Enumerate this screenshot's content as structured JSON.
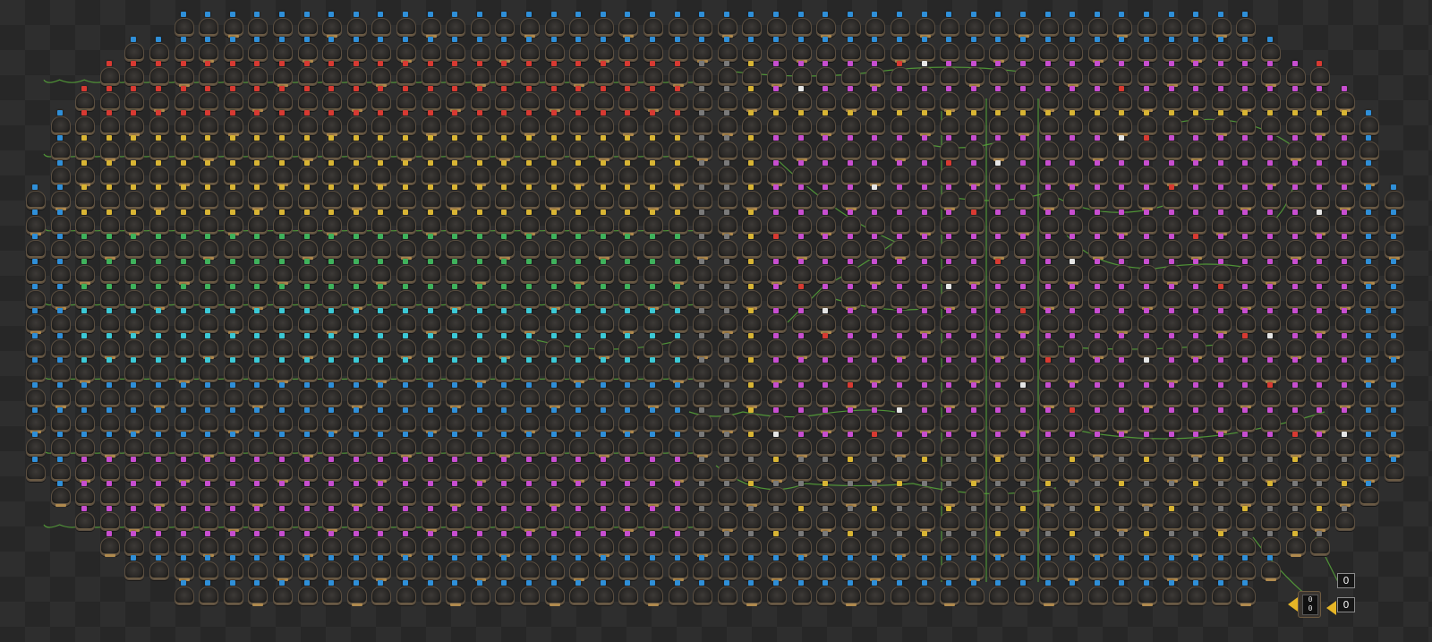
{
  "scene": "factorio-lamp-display",
  "signal_colors": {
    "blue": "#2f8fd8",
    "red": "#d83a32",
    "yellow": "#d9b534",
    "green": "#3fb25c",
    "cyan": "#3cc9d6",
    "magenta": "#c84ed0",
    "white": "#e6e6e6",
    "grey": "#7a7a7a"
  },
  "wire_color": "#57a63a",
  "combinators": [
    {
      "label": "decider-combinator",
      "display_top": "0",
      "display_bottom": "0"
    },
    {
      "label": "arithmetic-combinator",
      "display_top": "0"
    }
  ],
  "value_readouts": [
    {
      "label": "constant-readout-upper",
      "value": "0"
    },
    {
      "label": "constant-readout-lower",
      "value": "0"
    }
  ],
  "icons": {
    "lamp": "small-lamp-icon",
    "pole": "medium-electric-pole-icon",
    "combinator": "decider-combinator-icon",
    "arrow": "yellow-input-arrow-icon"
  }
}
